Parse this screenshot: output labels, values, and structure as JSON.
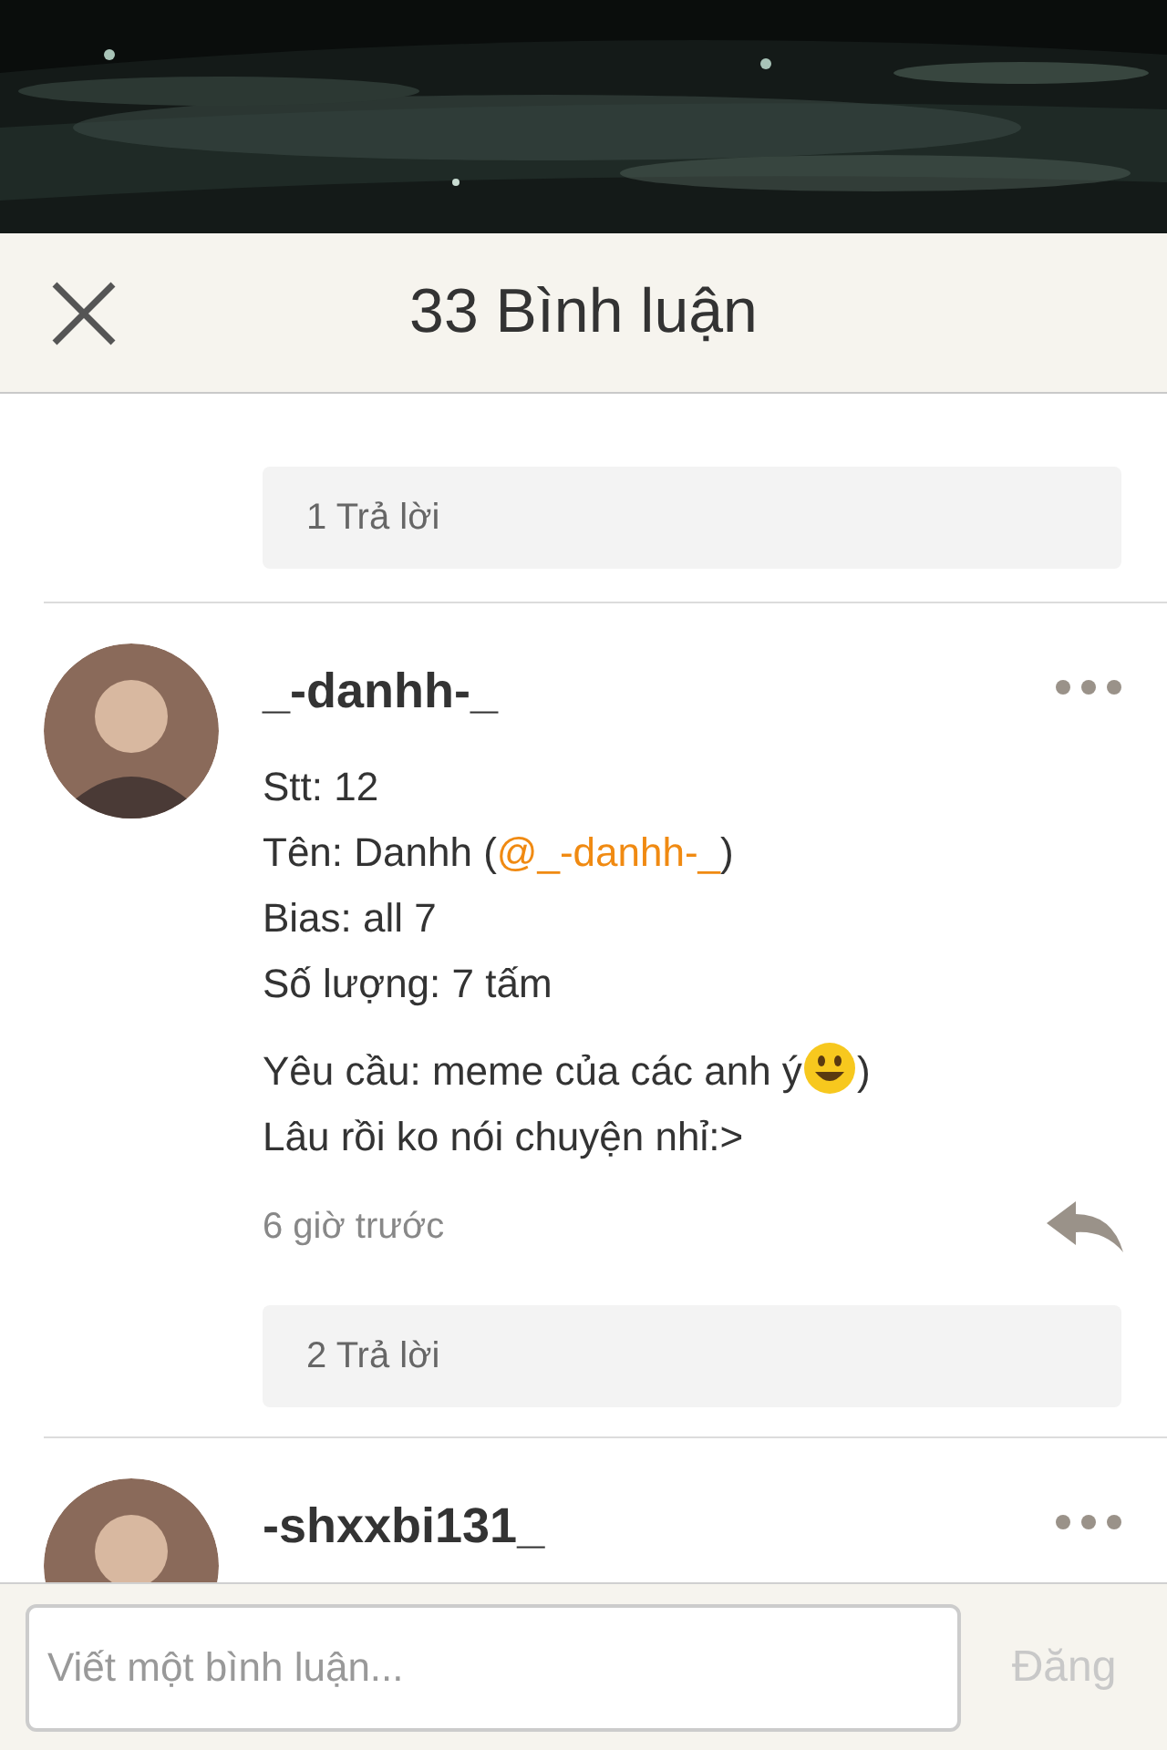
{
  "header": {
    "title": "33 Bình luận"
  },
  "previous_replies": "1 Trả lời",
  "comments": [
    {
      "author": "_-danhh-_",
      "paragraphs": [
        [
          [
            {
              "kind": "text",
              "text": "Stt: 12"
            }
          ],
          [
            {
              "kind": "text",
              "text": "Tên: Danhh ("
            },
            {
              "kind": "mention",
              "text": "@_-danhh-_"
            },
            {
              "kind": "text",
              "text": ")"
            }
          ],
          [
            {
              "kind": "text",
              "text": "Bias: all 7"
            }
          ],
          [
            {
              "kind": "text",
              "text": "Số lượng: 7 tấm"
            }
          ]
        ],
        [
          [
            {
              "kind": "text",
              "text": "Yêu cầu: meme của các anh ý"
            },
            {
              "kind": "emoji"
            },
            {
              "kind": "text",
              "text": ")"
            }
          ],
          [
            {
              "kind": "text",
              "text": "Lâu rồi ko nói chuyện nhỉ:>"
            }
          ]
        ]
      ],
      "time": "6 giờ trước",
      "replies": "2 Trả lời"
    },
    {
      "author": "-shxxbi131_"
    }
  ],
  "composer": {
    "placeholder": "Viết một bình luận...",
    "button": "Đăng",
    "disabled": true
  }
}
